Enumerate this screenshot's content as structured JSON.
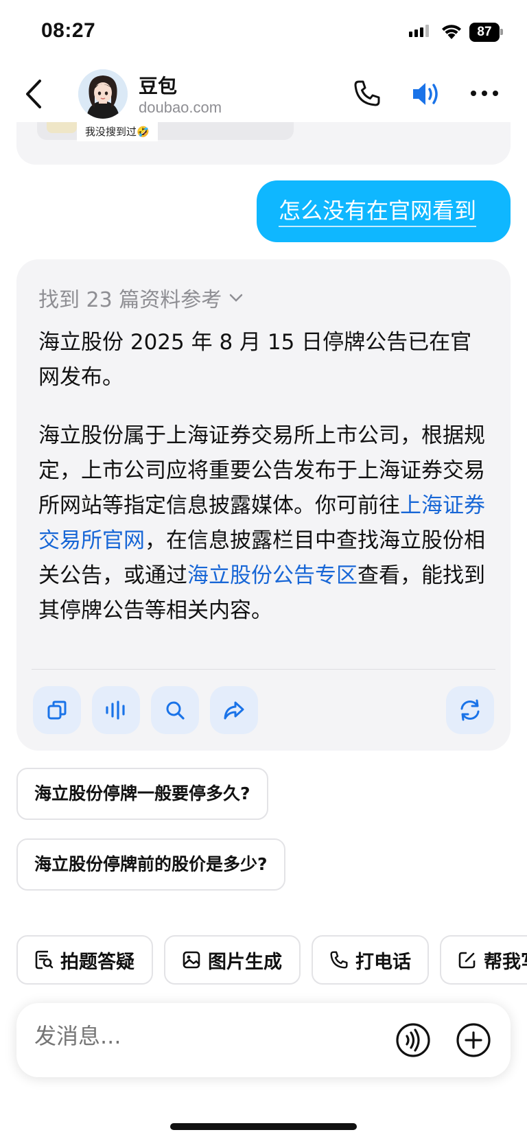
{
  "status_bar": {
    "time": "08:27",
    "battery": "87"
  },
  "header": {
    "name": "豆包",
    "site": "doubao.com"
  },
  "previous_card": {
    "caption": "我没搜到过🤣"
  },
  "user_message": "怎么没有在官网看到",
  "answer": {
    "refs_label": "找到 23 篇资料参考",
    "p1": "海立股份 2025 年 8 月 15 日停牌公告已在官网发布。",
    "p2_a": "海立股份属于上海证券交易所上市公司，根据规定，上市公司应将重要公告发布于上海证券交易所网站等指定信息披露媒体。你可前往",
    "p2_link1": "上海证券交易所官网",
    "p2_b": "，在信息披露栏目中查找海立股份相关公告，或通过",
    "p2_link2": "海立股份公告专区",
    "p2_c": "查看，能找到其停牌公告等相关内容。"
  },
  "suggestions": [
    "海立股份停牌一般要停多久?",
    "海立股份停牌前的股价是多少?"
  ],
  "tools": [
    {
      "label": "拍题答疑",
      "icon": "question-scan-icon"
    },
    {
      "label": "图片生成",
      "icon": "image-icon"
    },
    {
      "label": "打电话",
      "icon": "phone-icon"
    },
    {
      "label": "帮我写",
      "icon": "edit-icon"
    }
  ],
  "input": {
    "placeholder": "发消息..."
  },
  "colors": {
    "accent": "#0fb7ff",
    "link": "#1766d6",
    "card_bg": "#f4f4f6",
    "action_bg": "#e4edfb",
    "icon_blue": "#1a73e8"
  }
}
